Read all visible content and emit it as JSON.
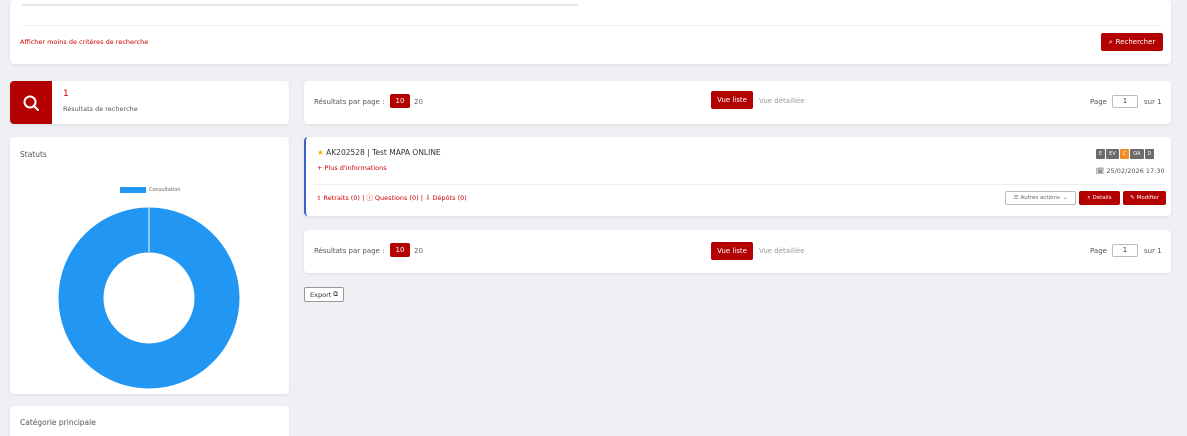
{
  "search_panel": {
    "less_criteria_link": "Afficher moins de critères de recherche",
    "search_button": "Rechercher"
  },
  "results_summary": {
    "count": "1",
    "label": "Résultats de recherche"
  },
  "pager_top": {
    "per_page_label": "Résultats par page :",
    "per_page_options": [
      "10",
      "20"
    ],
    "view_list": "Vue liste",
    "view_detailed": "Vue détaillée",
    "page_label": "Page",
    "page_value": "1",
    "page_total": "sur 1"
  },
  "pager_bottom": {
    "per_page_label": "Résultats par page :",
    "per_page_options": [
      "10",
      "20"
    ],
    "view_list": "Vue liste",
    "view_detailed": "Vue détaillée",
    "page_label": "Page",
    "page_value": "1",
    "page_total": "sur 1"
  },
  "result": {
    "title": "AK202528 | Test MAPA ONLINE",
    "more_info": "+ Plus d'informations",
    "badges": [
      {
        "text": "E",
        "color": "#6b6b6b"
      },
      {
        "text": "EV",
        "color": "#6b6b6b"
      },
      {
        "text": "C",
        "color": "#f28c28"
      },
      {
        "text": "OA",
        "color": "#6b6b6b"
      },
      {
        "text": "D",
        "color": "#6b6b6b"
      }
    ],
    "date": "25/02/2026 17:30",
    "links": {
      "retraits": "Retraits (0)",
      "questions": "Questions (0)",
      "depots": "Dépôts (0)"
    },
    "other_actions": "Autres actions",
    "details": "Détails",
    "modify": "Modifier"
  },
  "export_button": "Export",
  "statuts": {
    "title": "Statuts"
  },
  "categorie": {
    "title": "Catégorie principale"
  },
  "chart_data": {
    "type": "pie",
    "categories": [
      "Consultation"
    ],
    "values": [
      100
    ],
    "legend": "top",
    "colors": [
      "#2196f3"
    ]
  },
  "colors": {
    "accent": "#b30000",
    "chart_blue": "#2196f3"
  }
}
